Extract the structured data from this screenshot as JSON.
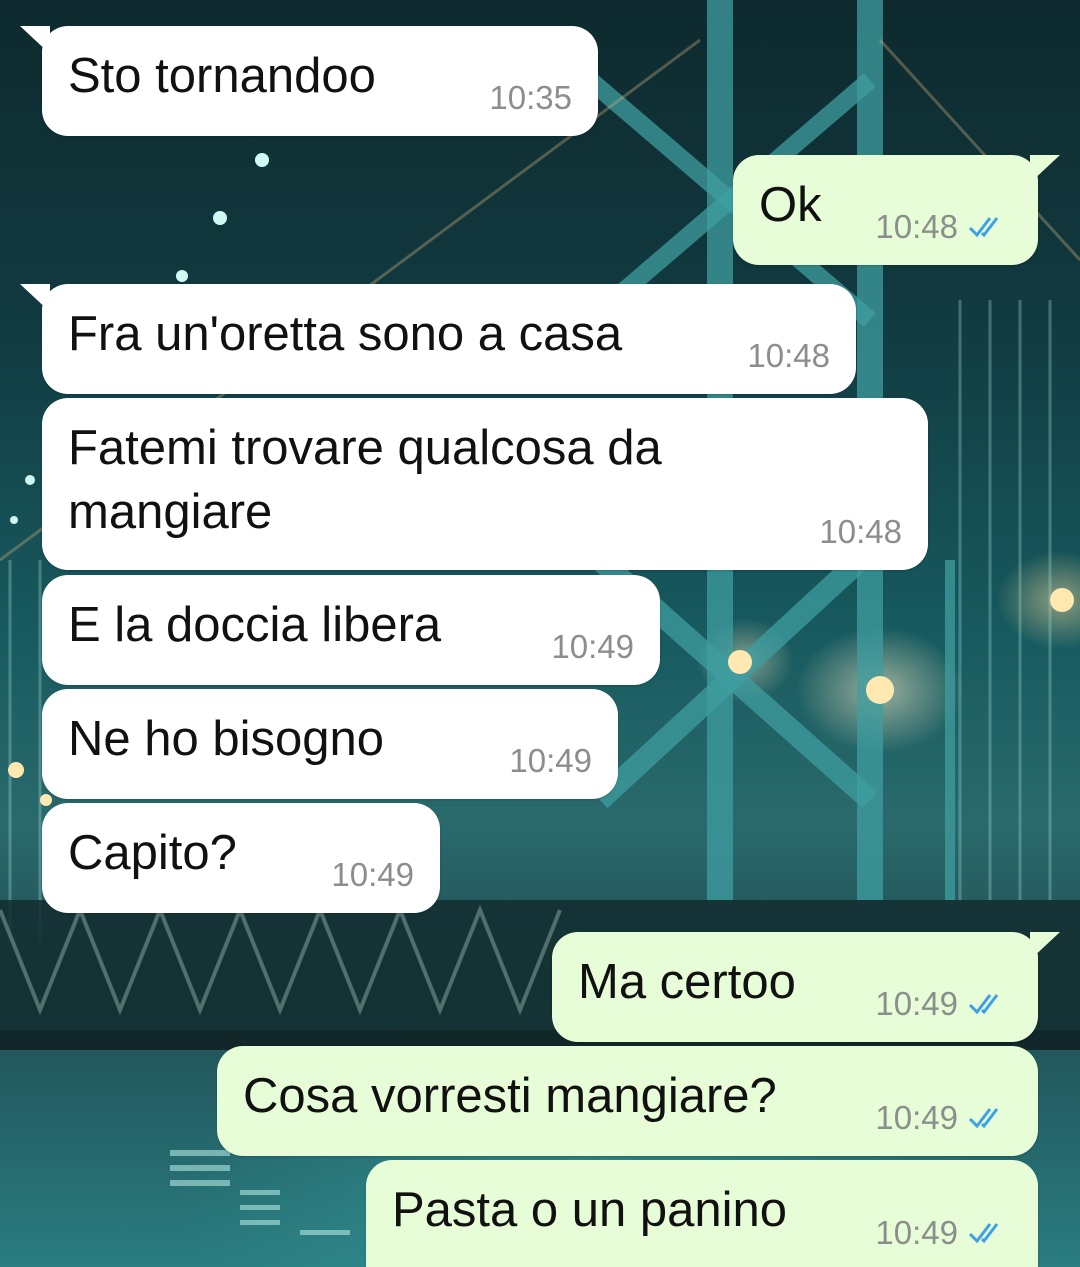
{
  "colors": {
    "incoming_bubble": "#ffffff",
    "outgoing_bubble": "#e7fdd7",
    "read_ticks": "#3ea1e6",
    "timestamp": "#8a8f8c"
  },
  "messages": [
    {
      "direction": "in",
      "text": "Sto tornandoo",
      "time": "10:35"
    },
    {
      "direction": "out",
      "text": "Ok",
      "time": "10:48",
      "status": "read",
      "status_icon": "double-check-icon"
    },
    {
      "direction": "in",
      "text": "Fra un'oretta sono a casa",
      "time": "10:48"
    },
    {
      "direction": "in",
      "text": "Fatemi trovare qualcosa da\nmangiare",
      "time": "10:48"
    },
    {
      "direction": "in",
      "text": "E la doccia libera",
      "time": "10:49"
    },
    {
      "direction": "in",
      "text": "Ne ho bisogno",
      "time": "10:49"
    },
    {
      "direction": "in",
      "text": "Capito?",
      "time": "10:49"
    },
    {
      "direction": "out",
      "text": "Ma certoo",
      "time": "10:49",
      "status": "read",
      "status_icon": "double-check-icon"
    },
    {
      "direction": "out",
      "text": "Cosa vorresti mangiare?",
      "time": "10:49",
      "status": "read",
      "status_icon": "double-check-icon"
    },
    {
      "direction": "out",
      "text": "Pasta o un panino",
      "time": "10:49",
      "status": "read",
      "status_icon": "double-check-icon"
    }
  ]
}
